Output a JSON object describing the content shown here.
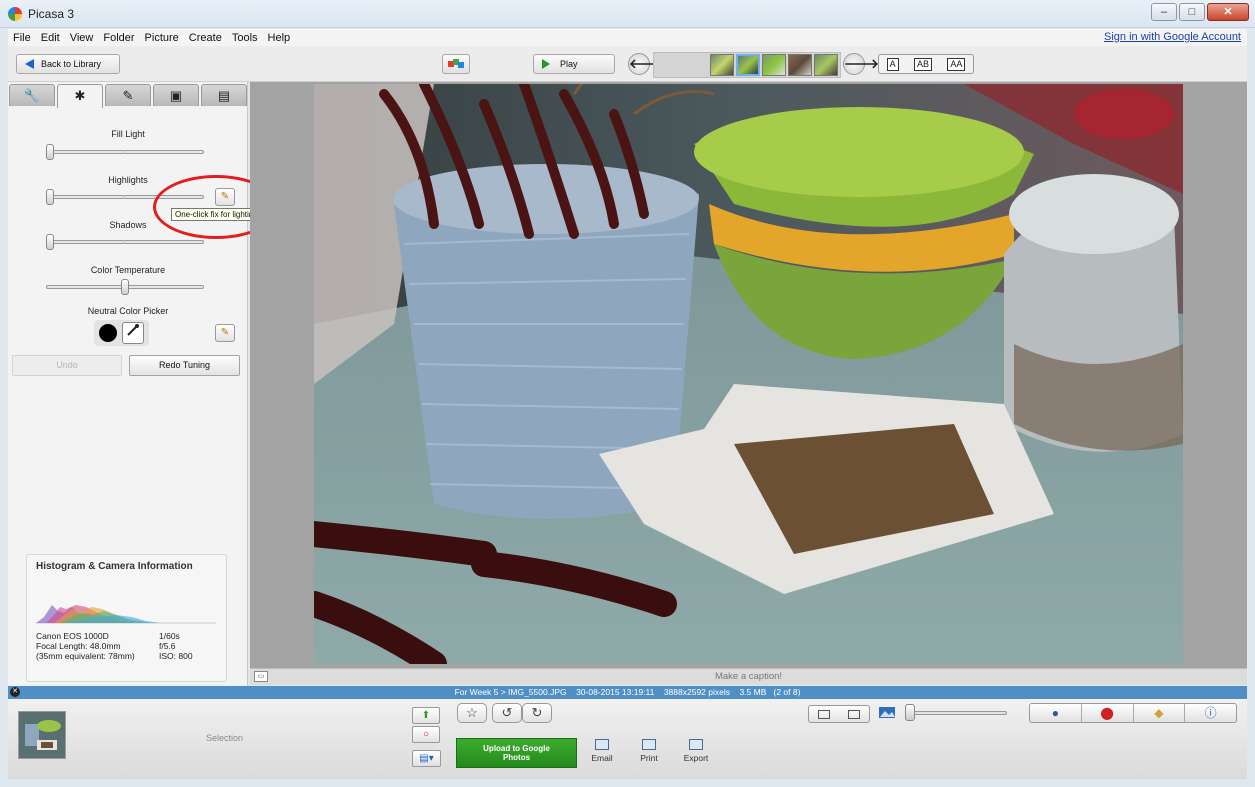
{
  "window": {
    "title": "Picasa 3",
    "min": "–",
    "max": "□",
    "close": "✕"
  },
  "menu": {
    "items": [
      "File",
      "Edit",
      "View",
      "Folder",
      "Picture",
      "Create",
      "Tools",
      "Help"
    ],
    "sign_in": "Sign in with Google Account"
  },
  "toolbar": {
    "back_label": "Back to Library",
    "play_label": "Play",
    "prev_arrow": "🡐",
    "next_arrow": "🡒",
    "text_buttons": [
      "A",
      "AB",
      "AA"
    ]
  },
  "edit_panel": {
    "tab_icons": [
      "wrench-icon",
      "sun-icon",
      "brush-icon",
      "paint-icon",
      "effects-icon"
    ],
    "tab_glyphs": [
      "🔧",
      "✱",
      "✎",
      "▣",
      "▤"
    ],
    "fill_light_label": "Fill Light",
    "fill_light_value": 0,
    "highlights_label": "Highlights",
    "highlights_value": 0,
    "shadows_label": "Shadows",
    "shadows_value": 0,
    "color_temp_label": "Color Temperature",
    "color_temp_value": 0.5,
    "neutral_picker_label": "Neutral Color Picker",
    "wand_glyph": "✎",
    "tooltip": "One-click fix for lighting",
    "undo_label": "Undo",
    "redo_label": "Redo Tuning"
  },
  "histogram": {
    "title": "Histogram & Camera Information",
    "camera_model": "Canon EOS 1000D",
    "focal_length": "Focal Length: 48.0mm",
    "equivalent": "(35mm equivalent:  78mm)",
    "shutter": "1/60s",
    "aperture": "f/5.6",
    "iso": "ISO: 800"
  },
  "caption": {
    "placeholder": "Make a caption!"
  },
  "info_bar": {
    "path": "For Week 5 > IMG_5500.JPG",
    "date": "30-08-2015 13:19:11",
    "dimensions": "3888x2592 pixels",
    "size": "3.5 MB",
    "index": "(2 of 8)"
  },
  "tray": {
    "selection_label": "Selection",
    "upload_label": "Upload to Google Photos",
    "email_label": "Email",
    "print_label": "Print",
    "export_label": "Export",
    "zoom_value": 0
  },
  "colors": {
    "accent_blue": "#4f8fc6",
    "upload_green": "#2e9a25",
    "annotation_red": "#e02020"
  }
}
